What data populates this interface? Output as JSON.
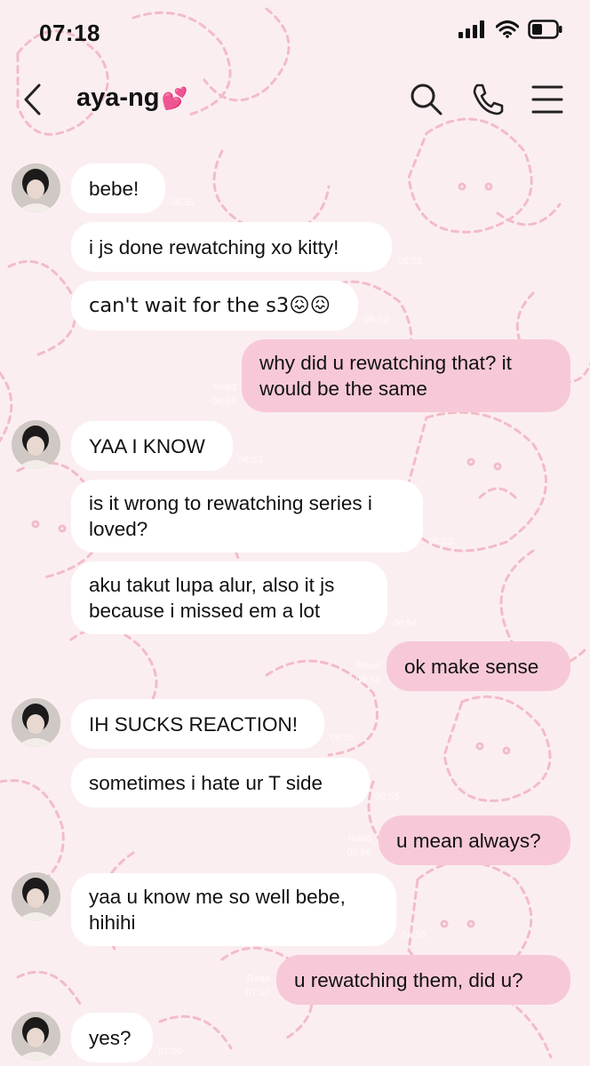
{
  "status": {
    "time": "07:18"
  },
  "header": {
    "title": "aya-ng",
    "title_emoji": "💕"
  },
  "messages": [
    {
      "text": "bebe!",
      "dir": "in",
      "time": "06:51"
    },
    {
      "text": "i js done rewatching xo kitty!",
      "dir": "in",
      "time": "06:52"
    },
    {
      "text": "can't wait for the s3😖😖",
      "dir": "in",
      "time": "06:52"
    },
    {
      "text": "why did u rewatching that? it would be the same",
      "dir": "out",
      "read": "Read",
      "time": "06:53"
    },
    {
      "text": "YAA I KNOW",
      "dir": "in",
      "time": "06:53"
    },
    {
      "text": "is it wrong to rewatching series i loved?",
      "dir": "in",
      "time": "06:53"
    },
    {
      "text": "aku takut lupa alur, also it js because i missed em a lot",
      "dir": "in",
      "time": "06:54"
    },
    {
      "text": "ok make sense",
      "dir": "out",
      "read": "Read",
      "time": "06:54"
    },
    {
      "text": "IH SUCKS REACTION!",
      "dir": "in",
      "time": "06:55"
    },
    {
      "text": "sometimes i hate ur T side",
      "dir": "in",
      "time": "06:55"
    },
    {
      "text": "u mean always?",
      "dir": "out",
      "read": "Read",
      "time": "06:56"
    },
    {
      "text": "yaa u know me so well bebe, hihihi",
      "dir": "in",
      "time": "06:56"
    },
    {
      "text": "u rewatching them, did u?",
      "dir": "out",
      "read": "Read",
      "time": "07:00"
    },
    {
      "text": "yes?",
      "dir": "in",
      "time": "07:00"
    }
  ],
  "colors": {
    "outgoing": "#f7c9d8",
    "incoming": "#ffffff",
    "background": "#fbeef0",
    "pattern": "#f2b8c4"
  },
  "icons": [
    "back-icon",
    "search-icon",
    "phone-icon",
    "menu-icon",
    "signal-icon",
    "wifi-icon",
    "battery-icon"
  ]
}
